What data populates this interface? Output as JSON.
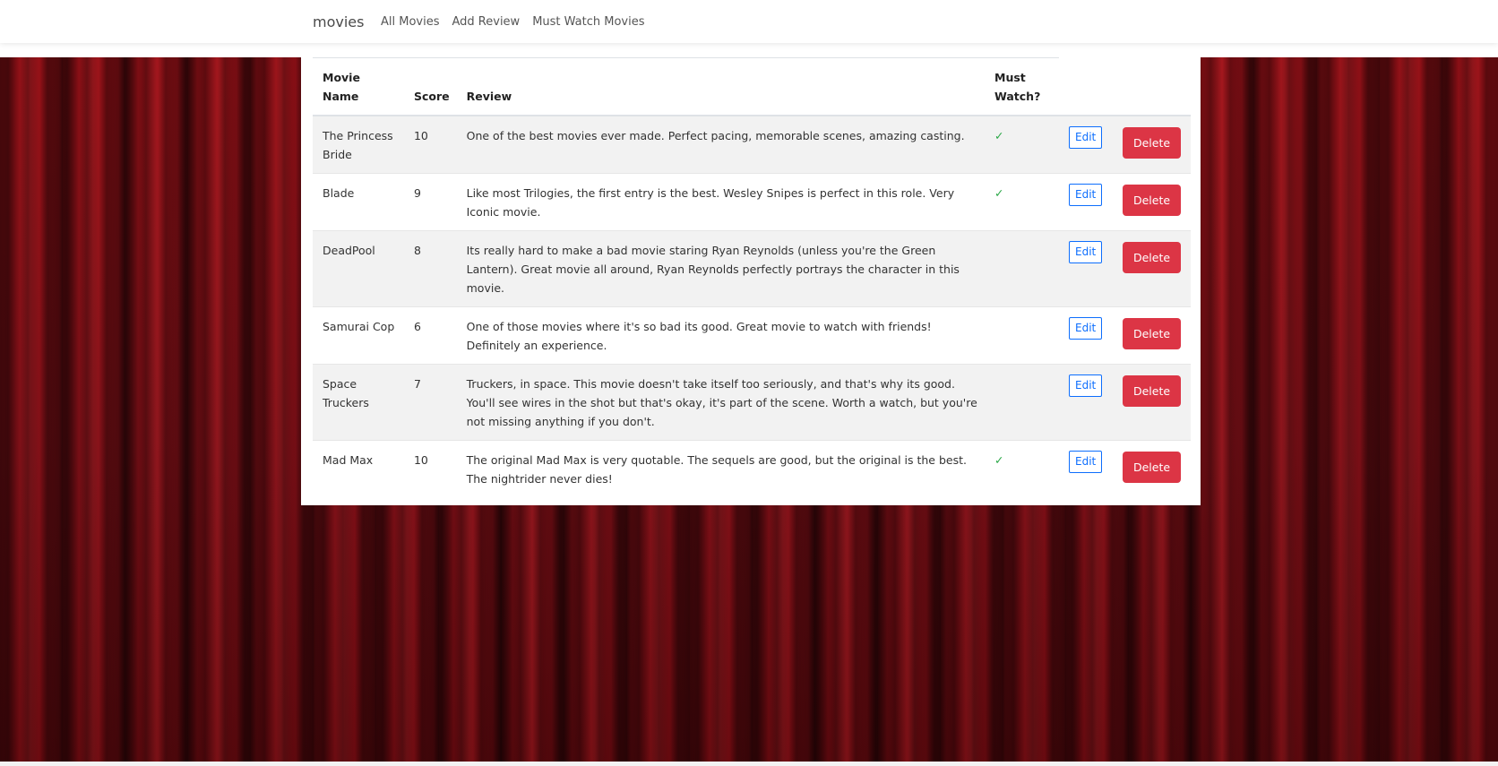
{
  "navbar": {
    "brand": "movies",
    "links": [
      "All Movies",
      "Add Review",
      "Must Watch Movies"
    ]
  },
  "table": {
    "headers": {
      "name_line1": "Movie",
      "name_line2": "Name",
      "score": "Score",
      "review": "Review",
      "must_line1": "Must",
      "must_line2": "Watch?"
    },
    "edit_label": "Edit",
    "delete_label": "Delete",
    "check_mark": "✓",
    "rows": [
      {
        "name": "The Princess Bride",
        "score": "10",
        "review": "One of the best movies ever made. Perfect pacing, memorable scenes, amazing casting.",
        "must_watch": true
      },
      {
        "name": "Blade",
        "score": "9",
        "review": "Like most Trilogies, the first entry is the best. Wesley Snipes is perfect in this role. Very Iconic movie.",
        "must_watch": true
      },
      {
        "name": "DeadPool",
        "score": "8",
        "review": "Its really hard to make a bad movie staring Ryan Reynolds (unless you're the Green Lantern). Great movie all around, Ryan Reynolds perfectly portrays the character in this movie.",
        "must_watch": false
      },
      {
        "name": "Samurai Cop",
        "score": "6",
        "review": "One of those movies where it's so bad its good. Great movie to watch with friends! Definitely an experience.",
        "must_watch": false
      },
      {
        "name": "Space Truckers",
        "score": "7",
        "review": "Truckers, in space. This movie doesn't take itself too seriously, and that's why its good. You'll see wires in the shot but that's okay, it's part of the scene. Worth a watch, but you're not missing anything if you don't.",
        "must_watch": false
      },
      {
        "name": "Mad Max",
        "score": "10",
        "review": "The original Mad Max is very quotable. The sequels are good, but the original is the best. The nightrider never dies!",
        "must_watch": true
      }
    ]
  },
  "colors": {
    "curtain": "#8b1018",
    "delete_button": "#dc3545",
    "edit_button_border": "#0d6efd",
    "check": "#28a745"
  }
}
